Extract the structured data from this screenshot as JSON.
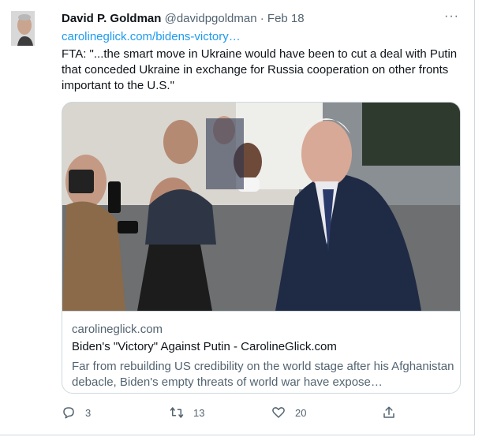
{
  "tweet": {
    "author_name": "David P. Goldman",
    "handle": "@davidpgoldman",
    "separator": "·",
    "date": "Feb 18",
    "more_label": "···",
    "link": "carolineglick.com/bidens-victory…",
    "text": "FTA: \"...the smart move in Ukraine would have been to cut a deal with Putin that conceded Ukraine in exchange for Russia cooperation on other fronts important to the U.S.\""
  },
  "card": {
    "domain": "carolineglick.com",
    "title": "Biden's \"Victory\" Against Putin - CarolineGlick.com",
    "description": "Far from rebuilding US credibility on the world stage after his Afghanistan debacle, Biden's empty threats of world war have expose…"
  },
  "actions": {
    "replies": "3",
    "retweets": "13",
    "likes": "20"
  },
  "colors": {
    "accent": "#1d9bf0",
    "muted": "#536471",
    "border": "#cfd9de"
  }
}
